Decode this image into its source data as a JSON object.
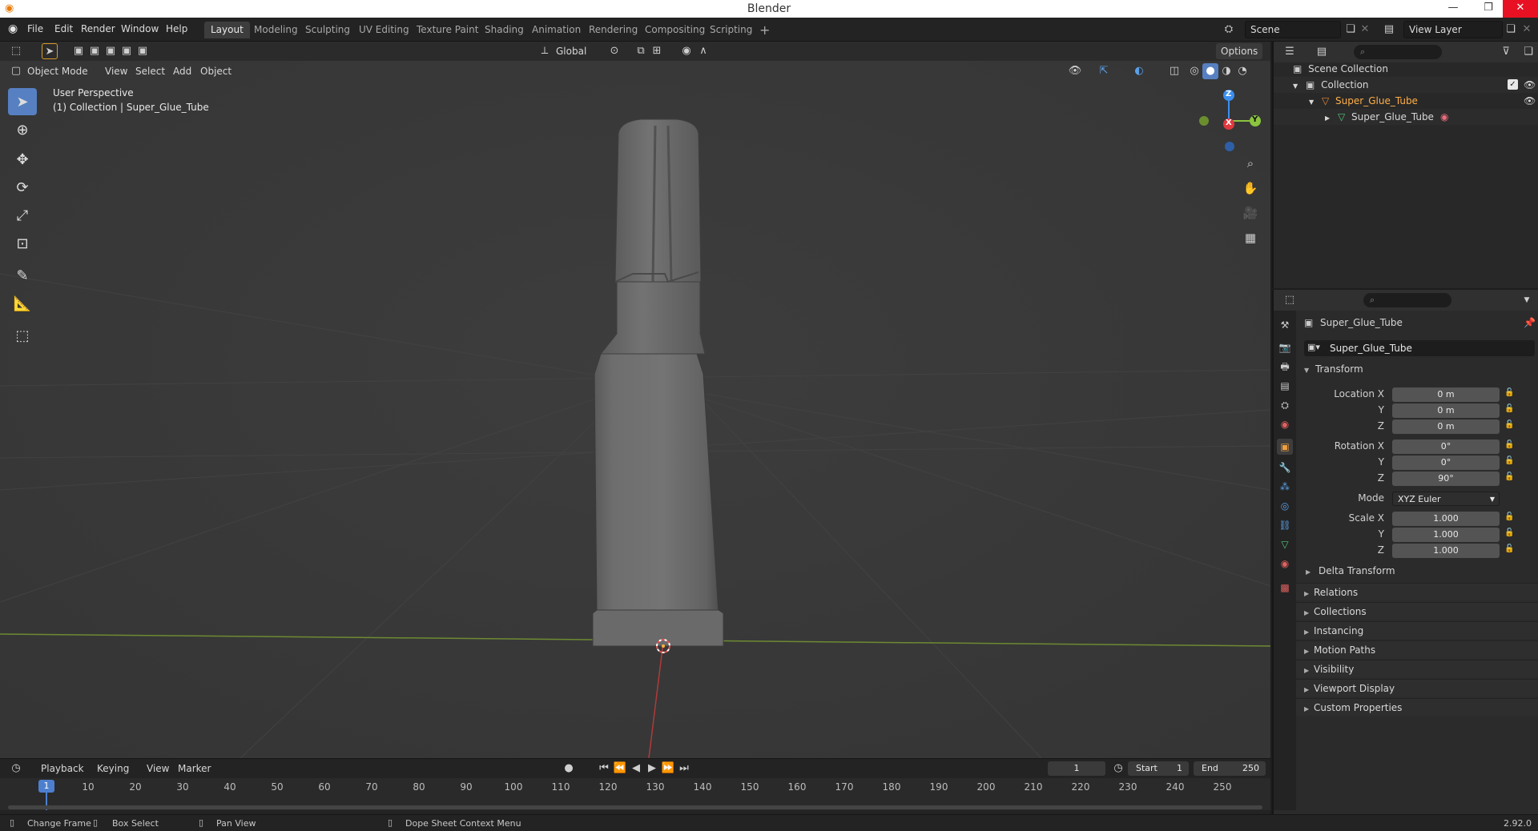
{
  "window": {
    "title": "Blender",
    "minimize": "—",
    "restore": "❐",
    "close": "✕"
  },
  "menu": [
    "File",
    "Edit",
    "Render",
    "Window",
    "Help"
  ],
  "workspace_tabs": [
    {
      "label": "Layout",
      "active": true
    },
    {
      "label": "Modeling"
    },
    {
      "label": "Sculpting"
    },
    {
      "label": "UV Editing"
    },
    {
      "label": "Texture Paint"
    },
    {
      "label": "Shading"
    },
    {
      "label": "Animation"
    },
    {
      "label": "Rendering"
    },
    {
      "label": "Compositing"
    },
    {
      "label": "Scripting"
    }
  ],
  "scene": {
    "value": "Scene"
  },
  "view_layer": {
    "value": "View Layer"
  },
  "viewport": {
    "transform_orientation": "Global",
    "options_label": "Options",
    "mode": "Object Mode",
    "header_menus": [
      "View",
      "Select",
      "Add",
      "Object"
    ],
    "overlay_line1": "User Perspective",
    "overlay_line2": "(1) Collection | Super_Glue_Tube",
    "gizmo": {
      "x": "X",
      "y": "Y",
      "z": "Z"
    },
    "colors": {
      "x_axis": "#e0393e",
      "y_axis": "#8ac43f",
      "z_axis": "#3b8ff0",
      "active_tool": "#5680c2"
    }
  },
  "outliner": {
    "rows": [
      {
        "label": "Scene Collection"
      },
      {
        "label": "Collection"
      },
      {
        "label": "Super_Glue_Tube"
      },
      {
        "label": "Super_Glue_Tube"
      }
    ]
  },
  "properties": {
    "object_name": "Super_Glue_Tube",
    "data_name": "Super_Glue_Tube",
    "transform_title": "Transform",
    "location_label": "Location X",
    "rotation_label": "Rotation X",
    "scale_label": "Scale X",
    "mode_label": "Mode",
    "axis_y": "Y",
    "axis_z": "Z",
    "location": [
      "0 m",
      "0 m",
      "0 m"
    ],
    "rotation": [
      "0°",
      "0°",
      "90°"
    ],
    "rotation_mode": "XYZ Euler",
    "scale": [
      "1.000",
      "1.000",
      "1.000"
    ],
    "delta_transform": "Delta Transform",
    "panels": [
      "Relations",
      "Collections",
      "Instancing",
      "Motion Paths",
      "Visibility",
      "Viewport Display",
      "Custom Properties"
    ]
  },
  "timeline": {
    "menus": [
      "Playback",
      "Keying",
      "View",
      "Marker"
    ],
    "current_frame": "1",
    "start_label": "Start",
    "start_value": "1",
    "end_label": "End",
    "end_value": "250",
    "ruler": [
      "10",
      "20",
      "30",
      "40",
      "50",
      "60",
      "70",
      "80",
      "90",
      "100",
      "110",
      "120",
      "130",
      "140",
      "150",
      "160",
      "170",
      "180",
      "190",
      "200",
      "210",
      "220",
      "230",
      "240",
      "250"
    ],
    "playhead": "1"
  },
  "status": {
    "items": [
      "Change Frame",
      "Box Select",
      "Pan View",
      "Dope Sheet Context Menu"
    ],
    "version": "2.92.0"
  }
}
